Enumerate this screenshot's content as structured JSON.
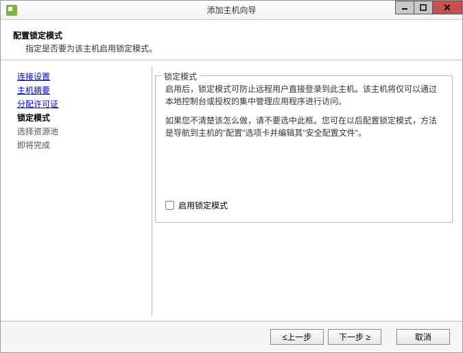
{
  "window": {
    "title": "添加主机向导"
  },
  "header": {
    "title": "配置锁定模式",
    "description": "指定是否要为该主机启用锁定模式。"
  },
  "sidebar": {
    "items": [
      {
        "label": "连接设置",
        "state": "link"
      },
      {
        "label": "主机摘要",
        "state": "link"
      },
      {
        "label": "分配许可证",
        "state": "link"
      },
      {
        "label": "锁定模式",
        "state": "current"
      },
      {
        "label": "选择资源池",
        "state": "pending"
      },
      {
        "label": "即将完成",
        "state": "pending"
      }
    ]
  },
  "main": {
    "fieldset_title": "锁定模式",
    "paragraph1": "启用后，锁定模式可防止远程用户直接登录到此主机。该主机将仅可以通过本地控制台或授权的集中管理应用程序进行访问。",
    "paragraph2": "如果您不清楚该怎么做，请不要选中此框。您可在以后配置锁定模式，方法是导航到主机的\"配置\"选项卡并编辑其\"安全配置文件\"。",
    "checkbox_label": "启用锁定模式"
  },
  "footer": {
    "back": "≤上一步",
    "next": "下一步 ≥",
    "cancel": "取消"
  }
}
